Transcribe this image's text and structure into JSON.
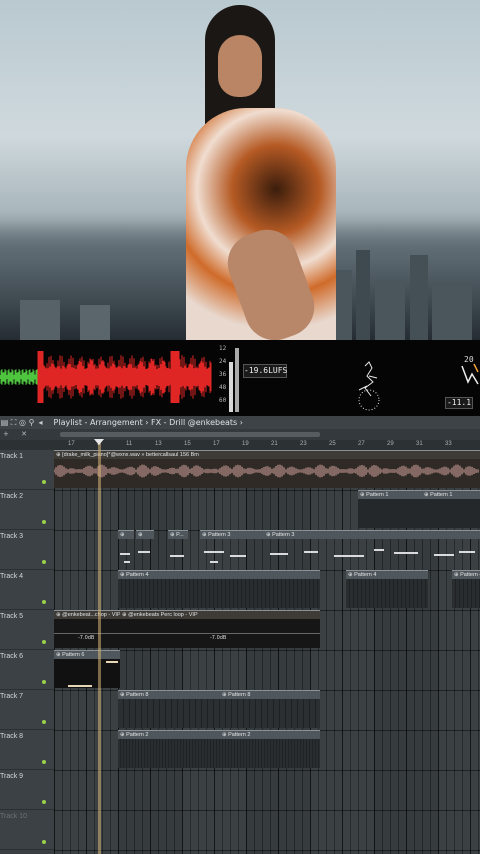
{
  "video": {
    "description_icon": "video-frame"
  },
  "meter": {
    "lufs_readout": "-19.6LUFS",
    "peak_readout": "-11.1",
    "right_value": "20",
    "scale": [
      "12",
      "24",
      "36",
      "48",
      "60"
    ]
  },
  "toolbar": {
    "breadcrumb": "Playlist - Arrangement › FX - Drill @enkebeats ›",
    "icons": [
      "menu-icon",
      "resize-icon",
      "record-icon",
      "magnet-icon",
      "speaker-icon"
    ]
  },
  "timeline": {
    "bars": [
      "17",
      "9",
      "11",
      "13",
      "15",
      "17",
      "19",
      "21",
      "23",
      "25",
      "27",
      "29",
      "31",
      "33"
    ]
  },
  "tracks": [
    {
      "label": "Track 1"
    },
    {
      "label": "Track 2"
    },
    {
      "label": "Track 3"
    },
    {
      "label": "Track 4"
    },
    {
      "label": "Track 5"
    },
    {
      "label": "Track 6"
    },
    {
      "label": "Track 7"
    },
    {
      "label": "Track 8"
    },
    {
      "label": "Track 9"
    },
    {
      "label": "Track 10"
    }
  ],
  "clips": {
    "track1_audio": "⊕ [drake_milk_piano]*@wxnx.wav » bettercallsaul 156 Bm",
    "track2_a": "⊕ Pattern 1",
    "track2_b": "⊕ Pattern 1",
    "track3_a": "⊕",
    "track3_b": "⊕",
    "track3_c": "⊕ P...",
    "track3_d": "⊕ Pattern 3",
    "track3_e": "⊕ Pattern 3",
    "track4_a": "⊕ Pattern 4",
    "track4_b": "⊕ Pattern 4",
    "track4_c": "⊕ Pattern 4",
    "track5_a": "⊕ @enkebeat...chop - VIP",
    "track5_b": "⊕ @enkebeats Perc loop - VIP",
    "track5_db1": "-7.0dB",
    "track5_db2": "-7.0dB",
    "track6_a": "⊕ Pattern 6",
    "track7_a": "⊕ Pattern 8",
    "track7_b": "⊕ Pattern 8",
    "track8_a": "⊕ Pattern 2",
    "track8_b": "⊕ Pattern 2"
  }
}
